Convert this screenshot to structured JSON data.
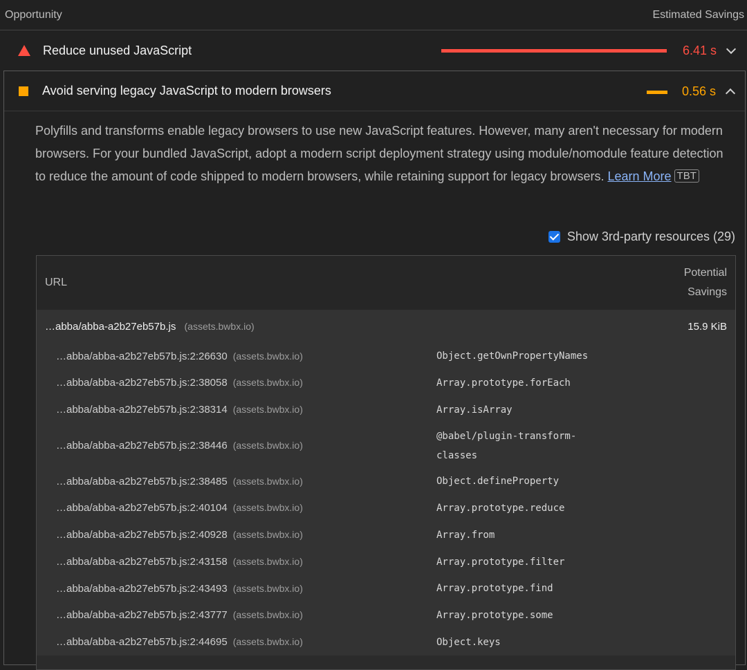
{
  "header": {
    "left": "Opportunity",
    "right": "Estimated Savings"
  },
  "audit1": {
    "title": "Reduce unused JavaScript",
    "savings": "6.41 s",
    "color": "#ff4e42"
  },
  "audit2": {
    "title": "Avoid serving legacy JavaScript to modern browsers",
    "savings": "0.56 s",
    "color": "#ffa400",
    "description": "Polyfills and transforms enable legacy browsers to use new JavaScript features. However, many aren't necessary for modern browsers. For your bundled JavaScript, adopt a modern script deployment strategy using module/nomodule feature detection to reduce the amount of code shipped to modern browsers, while retaining support for legacy browsers.",
    "learn_more": "Learn More",
    "tag": "TBT",
    "third_party_label": "Show 3rd-party resources (29)"
  },
  "table": {
    "col_url": "URL",
    "col_savings": "Potential Savings",
    "main": {
      "url": "…abba/abba-a2b27eb57b.js",
      "host": "(assets.bwbx.io)",
      "savings": "15.9 KiB"
    },
    "rows": [
      {
        "loc": "…abba/abba-a2b27eb57b.js:2:26630",
        "host": "(assets.bwbx.io)",
        "sig": "Object.getOwnPropertyNames"
      },
      {
        "loc": "…abba/abba-a2b27eb57b.js:2:38058",
        "host": "(assets.bwbx.io)",
        "sig": "Array.prototype.forEach"
      },
      {
        "loc": "…abba/abba-a2b27eb57b.js:2:38314",
        "host": "(assets.bwbx.io)",
        "sig": "Array.isArray"
      },
      {
        "loc": "…abba/abba-a2b27eb57b.js:2:38446",
        "host": "(assets.bwbx.io)",
        "sig": "@babel/plugin-transform-classes"
      },
      {
        "loc": "…abba/abba-a2b27eb57b.js:2:38485",
        "host": "(assets.bwbx.io)",
        "sig": "Object.defineProperty"
      },
      {
        "loc": "…abba/abba-a2b27eb57b.js:2:40104",
        "host": "(assets.bwbx.io)",
        "sig": "Array.prototype.reduce"
      },
      {
        "loc": "…abba/abba-a2b27eb57b.js:2:40928",
        "host": "(assets.bwbx.io)",
        "sig": "Array.from"
      },
      {
        "loc": "…abba/abba-a2b27eb57b.js:2:43158",
        "host": "(assets.bwbx.io)",
        "sig": "Array.prototype.filter"
      },
      {
        "loc": "…abba/abba-a2b27eb57b.js:2:43493",
        "host": "(assets.bwbx.io)",
        "sig": "Array.prototype.find"
      },
      {
        "loc": "…abba/abba-a2b27eb57b.js:2:43777",
        "host": "(assets.bwbx.io)",
        "sig": "Array.prototype.some"
      },
      {
        "loc": "…abba/abba-a2b27eb57b.js:2:44695",
        "host": "(assets.bwbx.io)",
        "sig": "Object.keys"
      }
    ]
  }
}
